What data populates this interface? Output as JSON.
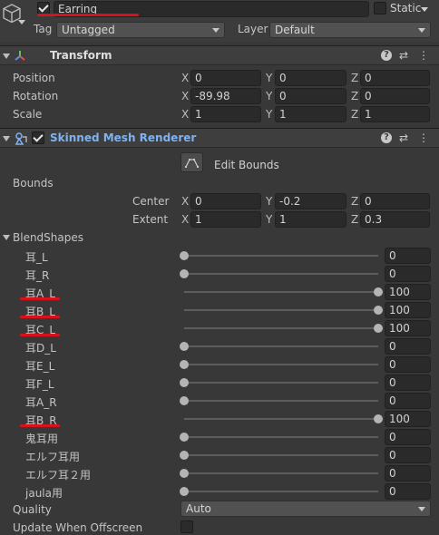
{
  "gameobject": {
    "name": "Earring",
    "static_label": "Static",
    "tag_label": "Tag",
    "tag_value": "Untagged",
    "layer_label": "Layer",
    "layer_value": "Default"
  },
  "transform": {
    "title": "Transform",
    "rows": [
      {
        "label": "Position",
        "x": "0",
        "y": "0",
        "z": "0"
      },
      {
        "label": "Rotation",
        "x": "-89.98",
        "y": "0",
        "z": "0"
      },
      {
        "label": "Scale",
        "x": "1",
        "y": "1",
        "z": "1"
      }
    ]
  },
  "axes": {
    "x": "X",
    "y": "Y",
    "z": "Z"
  },
  "header_icons": {
    "help": "?",
    "settings": "⇄",
    "menu": "⋮"
  },
  "smr": {
    "title": "Skinned Mesh Renderer",
    "edit_bounds": "Edit Bounds",
    "bounds_label": "Bounds",
    "center_label": "Center",
    "center": {
      "x": "0",
      "y": "-0.2",
      "z": "0"
    },
    "extent_label": "Extent",
    "extent": {
      "x": "1",
      "y": "1",
      "z": "0.3"
    },
    "blendshapes_label": "BlendShapes",
    "blendshapes": [
      {
        "name": "耳_L",
        "value": "0",
        "level": 0
      },
      {
        "name": "耳_R",
        "value": "0",
        "level": 0
      },
      {
        "name": "耳A_L",
        "value": "100",
        "level": 1
      },
      {
        "name": "耳B_L",
        "value": "100",
        "level": 1
      },
      {
        "name": "耳C_L",
        "value": "100",
        "level": 1
      },
      {
        "name": "耳D_L",
        "value": "0",
        "level": 0
      },
      {
        "name": "耳E_L",
        "value": "0",
        "level": 0
      },
      {
        "name": "耳F_L",
        "value": "0",
        "level": 0
      },
      {
        "name": "耳A_R",
        "value": "0",
        "level": 0
      },
      {
        "name": "耳B_R",
        "value": "100",
        "level": 1
      },
      {
        "name": "鬼耳用",
        "value": "0",
        "level": 0
      },
      {
        "name": "エルフ耳用",
        "value": "0",
        "level": 0
      },
      {
        "name": "エルフ耳２用",
        "value": "0",
        "level": 0
      },
      {
        "name": "jaula用",
        "value": "0",
        "level": 0
      }
    ],
    "quality_label": "Quality",
    "quality_value": "Auto",
    "offscreen_label": "Update When Offscreen"
  },
  "colors": {
    "annotation": "#d8121a",
    "smr_title": "#7fb2f0"
  }
}
